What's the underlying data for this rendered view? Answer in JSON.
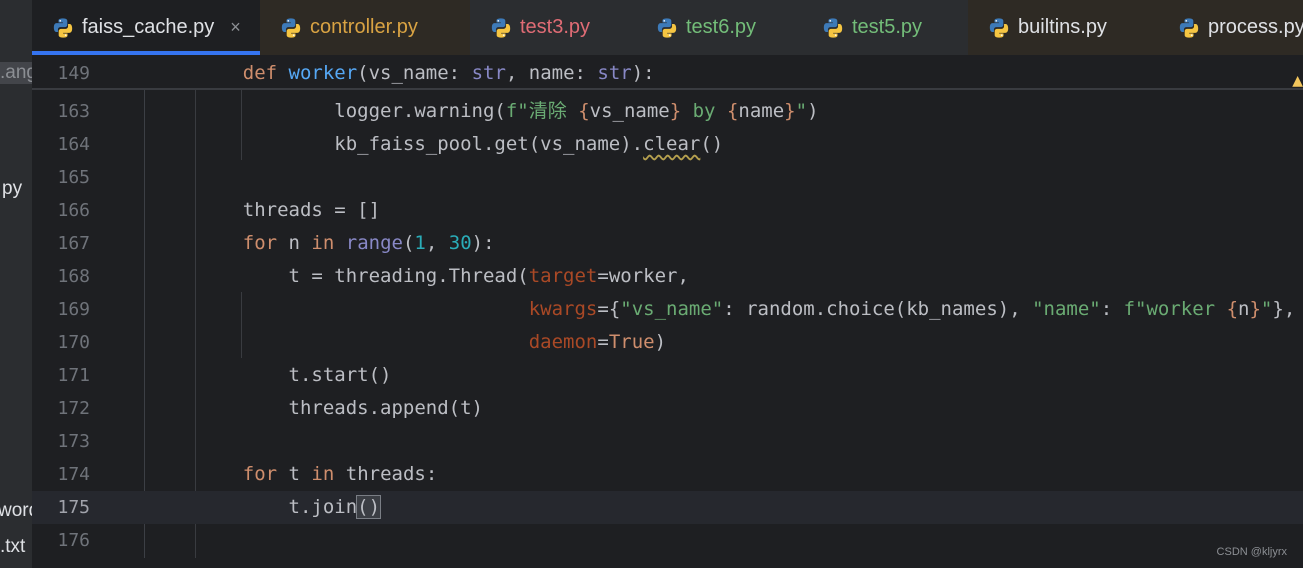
{
  "left_panel": {
    "fragments": [
      {
        "text": ".ang",
        "selected": true
      },
      {
        "text": "py",
        "selected": false
      },
      {
        "text": "word",
        "selected": false
      },
      {
        "text": ".txt",
        "selected": false
      }
    ]
  },
  "tabs": [
    {
      "label": "faiss_cache.py",
      "active": true,
      "color": "#dfe1e5",
      "bg": "#1e1f22"
    },
    {
      "label": "controller.py",
      "active": false,
      "color": "#d9a343",
      "bg": "#2e2a24"
    },
    {
      "label": "test3.py",
      "active": false,
      "color": "#e06c75",
      "bg": "#2b2d30"
    },
    {
      "label": "test6.py",
      "active": false,
      "color": "#73bd79",
      "bg": "#2b2d30"
    },
    {
      "label": "test5.py",
      "active": false,
      "color": "#73bd79",
      "bg": "#2b2d30"
    },
    {
      "label": "builtins.py",
      "active": false,
      "color": "#dfe1e5",
      "bg": "#2e2a24"
    },
    {
      "label": "process.py",
      "active": false,
      "color": "#dfe1e5",
      "bg": "#2e2a24"
    }
  ],
  "tab_close_glyph": "×",
  "editor": {
    "current_line": "175",
    "sticky": {
      "number": "149",
      "tokens": [
        {
          "t": "    ",
          "c": ""
        },
        {
          "t": "def ",
          "c": "kw"
        },
        {
          "t": "worker",
          "c": "fn"
        },
        {
          "t": "(vs_name: ",
          "c": ""
        },
        {
          "t": "str",
          "c": "bi"
        },
        {
          "t": ", name: ",
          "c": ""
        },
        {
          "t": "str",
          "c": "bi"
        },
        {
          "t": "):",
          "c": ""
        }
      ]
    },
    "lines": [
      {
        "number": "163",
        "tokens": [
          {
            "t": "            logger.warning(",
            "c": ""
          },
          {
            "t": "f\"清除 ",
            "c": "str"
          },
          {
            "t": "{",
            "c": "brace"
          },
          {
            "t": "vs_name",
            "c": "cn"
          },
          {
            "t": "}",
            "c": "brace"
          },
          {
            "t": " by ",
            "c": "str"
          },
          {
            "t": "{",
            "c": "brace"
          },
          {
            "t": "name",
            "c": "cn"
          },
          {
            "t": "}",
            "c": "brace"
          },
          {
            "t": "\"",
            "c": "str"
          },
          {
            "t": ")",
            "c": ""
          }
        ]
      },
      {
        "number": "164",
        "tokens": [
          {
            "t": "            kb_faiss_pool.get(vs_name).",
            "c": ""
          },
          {
            "t": "clear",
            "c": "squig"
          },
          {
            "t": "()",
            "c": ""
          }
        ]
      },
      {
        "number": "165",
        "tokens": []
      },
      {
        "number": "166",
        "tokens": [
          {
            "t": "    threads = []",
            "c": ""
          }
        ]
      },
      {
        "number": "167",
        "tokens": [
          {
            "t": "    ",
            "c": ""
          },
          {
            "t": "for",
            "c": "kw"
          },
          {
            "t": " n ",
            "c": ""
          },
          {
            "t": "in",
            "c": "kw"
          },
          {
            "t": " ",
            "c": ""
          },
          {
            "t": "range",
            "c": "bi"
          },
          {
            "t": "(",
            "c": ""
          },
          {
            "t": "1",
            "c": "num"
          },
          {
            "t": ", ",
            "c": ""
          },
          {
            "t": "30",
            "c": "num"
          },
          {
            "t": "):",
            "c": ""
          }
        ]
      },
      {
        "number": "168",
        "tokens": [
          {
            "t": "        t = threading.Thread(",
            "c": ""
          },
          {
            "t": "target",
            "c": "param"
          },
          {
            "t": "=worker,",
            "c": ""
          }
        ]
      },
      {
        "number": "169",
        "tokens": [
          {
            "t": "                             ",
            "c": ""
          },
          {
            "t": "kwargs",
            "c": "param"
          },
          {
            "t": "={",
            "c": ""
          },
          {
            "t": "\"vs_name\"",
            "c": "str"
          },
          {
            "t": ": random.choice(kb_names), ",
            "c": ""
          },
          {
            "t": "\"name\"",
            "c": "str"
          },
          {
            "t": ": ",
            "c": ""
          },
          {
            "t": "f\"worker ",
            "c": "str"
          },
          {
            "t": "{",
            "c": "brace"
          },
          {
            "t": "n",
            "c": "cn"
          },
          {
            "t": "}",
            "c": "brace"
          },
          {
            "t": "\"",
            "c": "str"
          },
          {
            "t": "},",
            "c": ""
          }
        ]
      },
      {
        "number": "170",
        "tokens": [
          {
            "t": "                             ",
            "c": ""
          },
          {
            "t": "daemon",
            "c": "param"
          },
          {
            "t": "=",
            "c": ""
          },
          {
            "t": "True",
            "c": "kw"
          },
          {
            "t": ")",
            "c": ""
          }
        ]
      },
      {
        "number": "171",
        "tokens": [
          {
            "t": "        t.start()",
            "c": ""
          }
        ]
      },
      {
        "number": "172",
        "tokens": [
          {
            "t": "        threads.append(t)",
            "c": ""
          }
        ]
      },
      {
        "number": "173",
        "tokens": []
      },
      {
        "number": "174",
        "tokens": [
          {
            "t": "    ",
            "c": ""
          },
          {
            "t": "for",
            "c": "kw"
          },
          {
            "t": " t ",
            "c": ""
          },
          {
            "t": "in",
            "c": "kw"
          },
          {
            "t": " threads:",
            "c": ""
          }
        ]
      },
      {
        "number": "175",
        "tokens": [
          {
            "t": "        t.join",
            "c": ""
          },
          {
            "t": "()",
            "c": "bracket-hl"
          }
        ]
      },
      {
        "number": "176",
        "tokens": []
      }
    ]
  },
  "watermark": "CSDN @kljyrx",
  "colors": {
    "background": "#1e1f22",
    "tabbar": "#2b2d30",
    "accent": "#3574f0",
    "keyword": "#cf8e6d",
    "function": "#56a8f5",
    "builtin": "#8888c6",
    "number": "#2aacb8",
    "string": "#6aab73",
    "parameter": "#aa4926"
  }
}
